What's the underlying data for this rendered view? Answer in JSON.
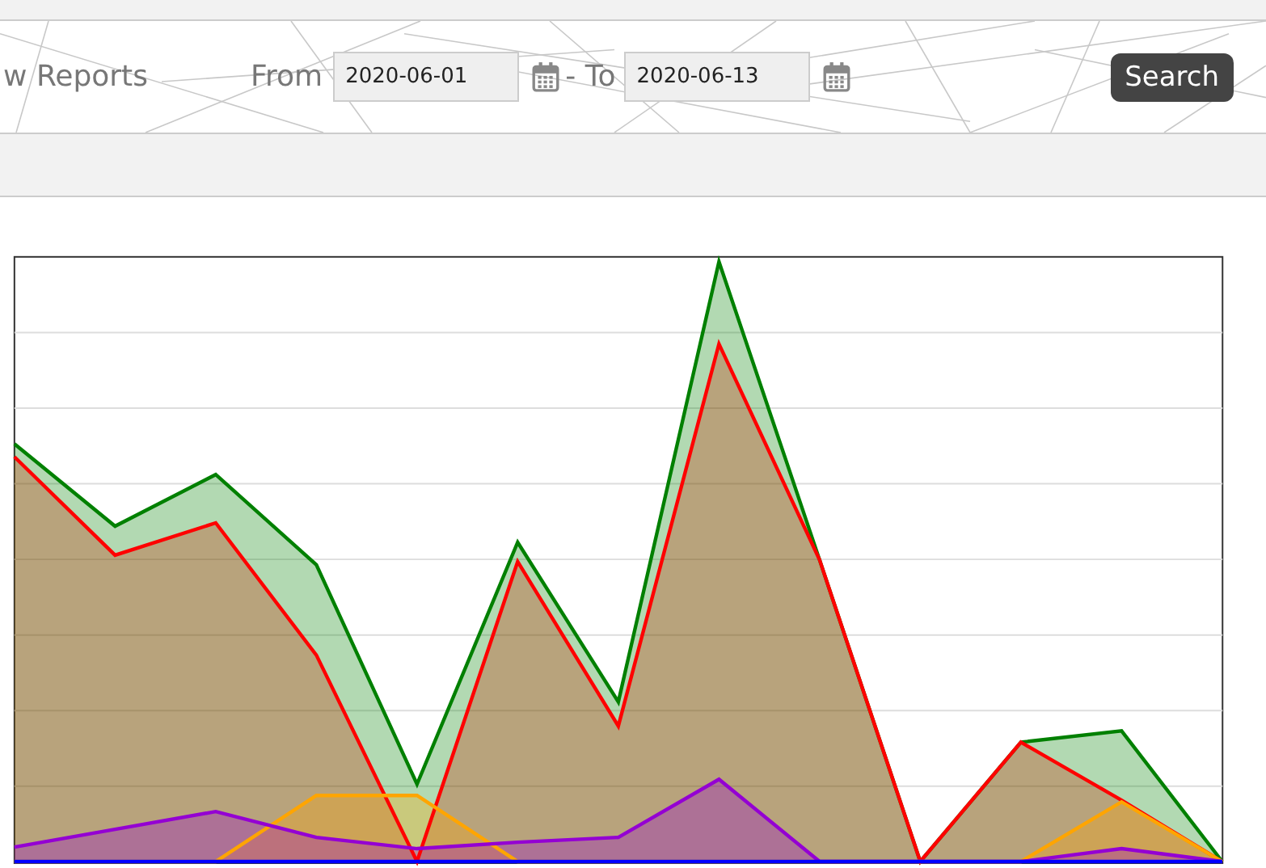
{
  "header": {
    "title": "w Reports",
    "from_label": "From",
    "from_date": "2020-06-01",
    "to_label": "- To",
    "to_date": "2020-06-13",
    "search_button": "Search"
  }
}
